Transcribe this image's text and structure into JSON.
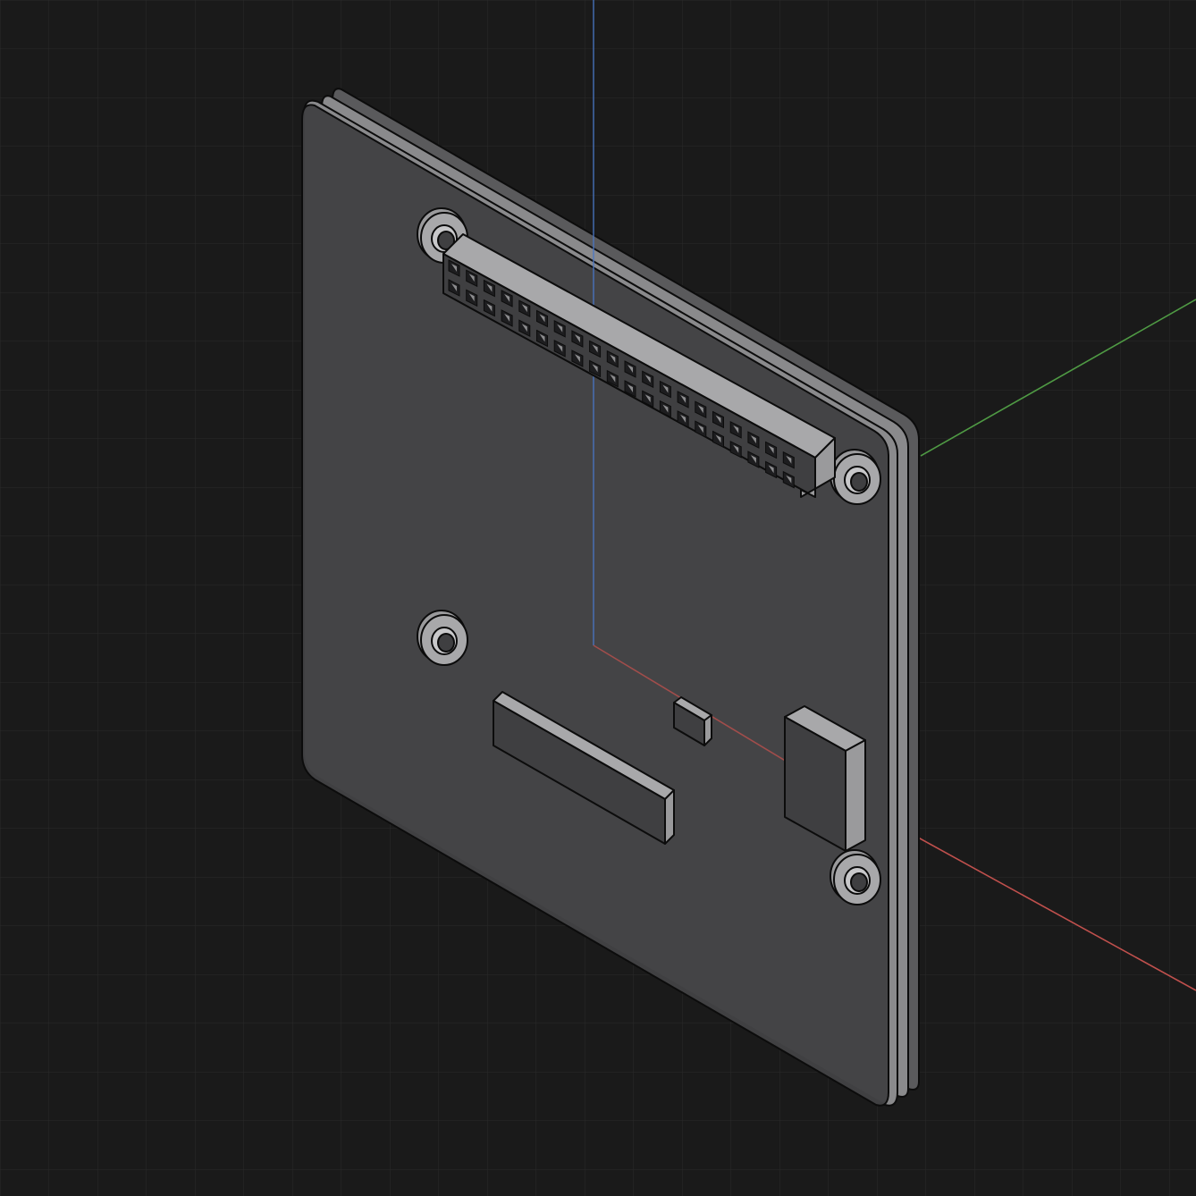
{
  "viewport": {
    "background": "#1a1a1a",
    "grid": {
      "visible": true,
      "color": "#2a2a2a"
    },
    "axes": {
      "x": {
        "color": "#c0504d"
      },
      "y": {
        "color": "#4f9a44"
      },
      "z": {
        "color": "#4a78c8"
      }
    }
  },
  "model": {
    "board_colors": {
      "front": "#424244",
      "edge": "#8a8a8c",
      "back": "#5a5a5c"
    },
    "component_colors": {
      "top": "#a8a8aa",
      "side": "#9a9a9c",
      "face": "#3f3f41",
      "pin_hole": "#1d1d1f"
    },
    "header": {
      "rows": 2,
      "cols": 20
    },
    "mounting_holes": 4
  }
}
